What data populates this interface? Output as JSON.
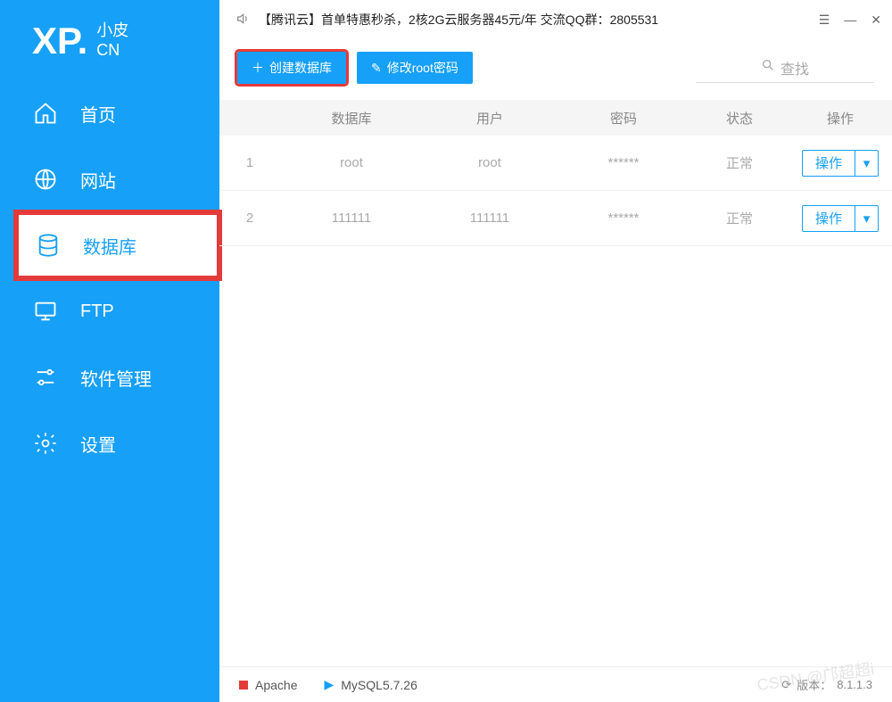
{
  "logo": {
    "main": "XP.",
    "line1": "小皮",
    "line2": "CN"
  },
  "sidebar": {
    "items": [
      {
        "label": "首页"
      },
      {
        "label": "网站"
      },
      {
        "label": "数据库"
      },
      {
        "label": "FTP"
      },
      {
        "label": "软件管理"
      },
      {
        "label": "设置"
      }
    ]
  },
  "titlebar": {
    "text": "【腾讯云】首单特惠秒杀，2核2G云服务器45元/年 交流QQ群：2805531"
  },
  "toolbar": {
    "create_db_label": "创建数据库",
    "modify_root_label": "修改root密码",
    "search_placeholder": "查找"
  },
  "table": {
    "headers": {
      "db": "数据库",
      "user": "用户",
      "pwd": "密码",
      "status": "状态",
      "action": "操作"
    },
    "rows": [
      {
        "idx": "1",
        "db": "root",
        "user": "root",
        "pwd": "******",
        "status": "正常",
        "action": "操作"
      },
      {
        "idx": "2",
        "db": "111111",
        "user": "111111",
        "pwd": "******",
        "status": "正常",
        "action": "操作"
      }
    ]
  },
  "statusbar": {
    "apache": "Apache",
    "mysql": "MySQL5.7.26",
    "version_label": "版本：",
    "version": "8.1.1.3"
  },
  "watermark": "CSDN @邝超超i"
}
